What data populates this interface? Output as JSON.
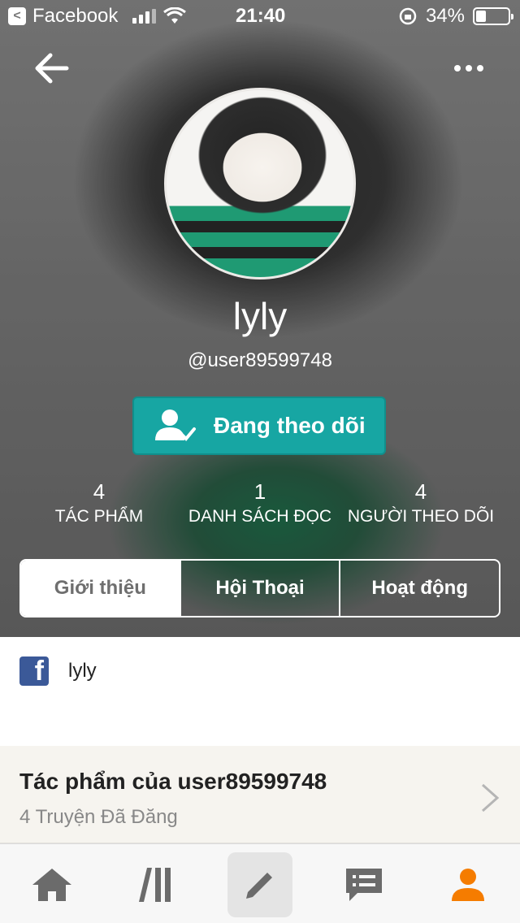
{
  "status_bar": {
    "back_app": "Facebook",
    "time": "21:40",
    "battery": "34%"
  },
  "profile": {
    "name": "lyly",
    "handle": "@user89599748",
    "follow_button_label": "Đang theo dõi"
  },
  "stats": [
    {
      "value": "4",
      "label": "TÁC PHẨM"
    },
    {
      "value": "1",
      "label": "DANH SÁCH ĐỌC"
    },
    {
      "value": "4",
      "label": "NGƯỜI THEO DÕI"
    }
  ],
  "tabs": [
    {
      "label": "Giới thiệu",
      "active": true
    },
    {
      "label": "Hội Thoại",
      "active": false
    },
    {
      "label": "Hoạt động",
      "active": false
    }
  ],
  "about": {
    "facebook_name": "lyly"
  },
  "works": {
    "title": "Tác phẩm của user89599748",
    "subtitle": "4 Truyện Đã Đăng"
  },
  "bottom_nav": {
    "items": [
      "home-icon",
      "library-icon",
      "write-icon",
      "messages-icon",
      "profile-icon"
    ],
    "active": "profile-icon",
    "active_color": "#f57c00"
  },
  "colors": {
    "accent": "#17a6a3",
    "facebook": "#3b5998"
  }
}
